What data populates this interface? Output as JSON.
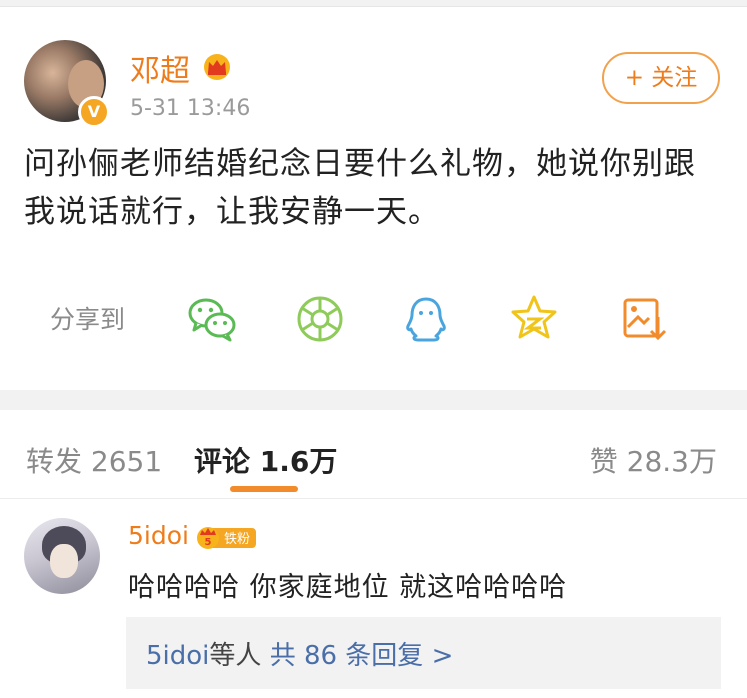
{
  "post": {
    "author": "邓超",
    "time": "5-31 13:46",
    "follow_label": "+ 关注",
    "verified_mark": "V",
    "content": "问孙俪老师结婚纪念日要什么礼物，她说你别跟我说话就行，让我安静一天。",
    "share_label": "分享到",
    "share_icons": [
      "wechat-icon",
      "moments-icon",
      "qq-icon",
      "qzone-icon",
      "save-image-icon"
    ]
  },
  "tabs": {
    "repost": "转发 2651",
    "comments": "评论 1.6万",
    "likes": "赞 28.3万"
  },
  "comment": {
    "user": "5idoi",
    "badge_level": "5",
    "badge_text": "铁粉",
    "text": "哈哈哈哈 你家庭地位 就这哈哈哈哈",
    "replies_user": "5idoi",
    "replies_mid": "等人",
    "replies_count": "共 86 条回复 >"
  },
  "colors": {
    "accent": "#ef7c1b",
    "link": "#4a6ea8",
    "wechat": "#5aba54",
    "moments": "#8ecb5a",
    "qq": "#4aa5de",
    "qzone": "#f0c419",
    "save": "#f28b2c"
  }
}
